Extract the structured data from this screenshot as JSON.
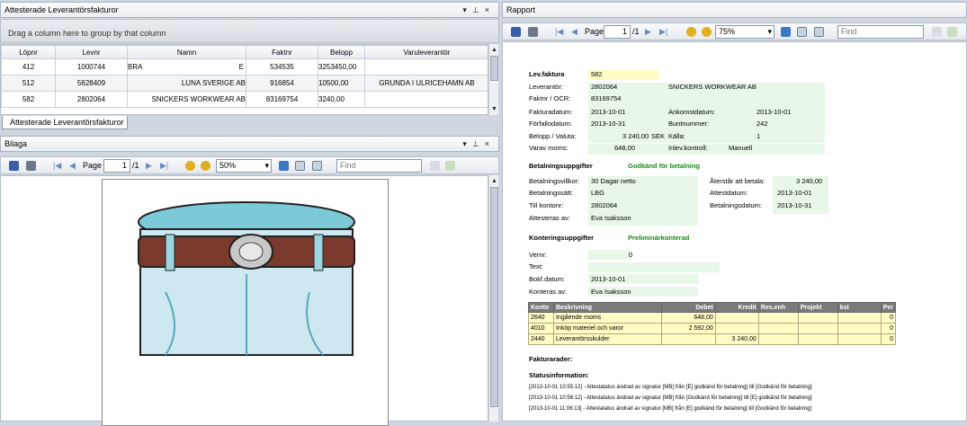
{
  "left_top": {
    "title": "Attesterade Leverantörsfakturor",
    "group_hint": "Drag a column here to group by that column",
    "columns": [
      "Löpnr",
      "Levnr",
      "Namn",
      "Faktnr",
      "Belopp",
      "Varuleverantör"
    ],
    "rows": [
      [
        "412",
        "1000744",
        "BRA",
        "534535",
        "3253450,00",
        ""
      ],
      [
        "512",
        "5628409",
        "LUNA SVERIGE AB",
        "916854",
        "10500,00",
        "GRUNDA I ULRICEHAMN AB"
      ],
      [
        "582",
        "2802064",
        "SNICKERS WORKWEAR AB",
        "83169754",
        "3240,00",
        ""
      ]
    ],
    "row0_extra": "E",
    "tab_label": "Attesterade Leverantörsfakturor"
  },
  "bilaga": {
    "title": "Bilaga",
    "page_label": "Page",
    "page_value": "1",
    "page_total": "/1",
    "zoom": "50%",
    "find_placeholder": "Find"
  },
  "rapport": {
    "title": "Rapport",
    "page_label": "Page",
    "page_value": "1",
    "page_total": "/1",
    "zoom": "75%",
    "find_placeholder": "Find",
    "lev_faktura_label": "Lev.faktura",
    "lev_faktura_value": "582",
    "leverantor_label": "Leverantör:",
    "leverantor_nr": "2802064",
    "leverantor_namn": "SNICKERS WORKWEAR AB",
    "faktnr_label": "Faktnr / OCR:",
    "faktnr_value": "83169754",
    "fakturadatum_label": "Fakturadatum:",
    "fakturadatum": "2013-10-01",
    "ankomstdatum_label": "Ankomstdatum:",
    "ankomstdatum": "2013-10-01",
    "forfallodatum_label": "Förfallodatum:",
    "forfallodatum": "2013-10-31",
    "buntnummer_label": "Buntnummer:",
    "buntnummer": "242",
    "belopp_label": "Belopp / Valuta:",
    "belopp": "3 240,00",
    "valuta": "SEK",
    "kalla_label": "Källa:",
    "kalla": "1",
    "varav_moms_label": "Varav moms:",
    "varav_moms": "648,00",
    "inlev_label": "Inlev.kontroll:",
    "inlev": "Manuell",
    "betalning_header": "Betalningsuppgifter",
    "betalning_status": "Godkänd för betalning",
    "betalningsvillkor_label": "Betalningsvillkor:",
    "betalningsvillkor": "30 Dagar netto",
    "aterstar_label": "Återstår att betala:",
    "aterstar": "3 240,00",
    "betalningssatt_label": "Betalningssätt:",
    "betalningssatt": "LBG",
    "attestdatum_label": "Attestdatum:",
    "attestdatum": "2013-10-01",
    "till_kontonr_label": "Till kontonr:",
    "till_kontonr": "2802064",
    "betalningsdatum_label": "Betalningsdatum:",
    "betalningsdatum": "2013-10-31",
    "attesteras_label": "Attesteras av:",
    "attesteras": "Eva Isaksson",
    "kontering_header": "Konteringsuppgifter",
    "kontering_status": "Preliminärkonterad",
    "vernr_label": "Vernr:",
    "vernr": "0",
    "text_label": "Text:",
    "text": "",
    "bokf_label": "Bokf.datum:",
    "bokf": "2013-10-01",
    "konteras_label": "Konteras av:",
    "konteras": "Eva Isaksson",
    "kont_columns": [
      "Konto",
      "Beskrivning",
      "Debet",
      "Kredit",
      "Res.enh",
      "Projekt",
      "kst",
      "Per"
    ],
    "kont_rows": [
      [
        "2640",
        "Ingående moms",
        "648,00",
        "",
        "",
        "",
        "",
        "0"
      ],
      [
        "4010",
        "Inköp materiel och varor",
        "2 592,00",
        "",
        "",
        "",
        "",
        "0"
      ],
      [
        "2440",
        "Leverantörsskulder",
        "",
        "3 240,00",
        "",
        "",
        "",
        "0"
      ]
    ],
    "fakturarader_label": "Fakturarader:",
    "statusinfo_label": "Statusinformation:",
    "status_lines": [
      "[2013-10-01 10:55:12] - Attestatatus ändrad av signatur [MB] från [E] godkänd för betalning] till [Godkänd för betalning]",
      "[2013-10-01 10:56:12] - Attestatatus ändrad av signatur [MB] från [Godkänd för betalning] till [E] godkänd för betalning]",
      "[2013-10-01 11:06:13] - Attestatatus ändrad av signatur [MB] från [E] godkänd för betalning] till [Godkänd för betalning]"
    ]
  },
  "colors": {
    "accent": "#2a5ea8",
    "status_green": "#1a8a1a",
    "yellow_field": "#fffcc4",
    "green_field": "#e8f7e8"
  }
}
